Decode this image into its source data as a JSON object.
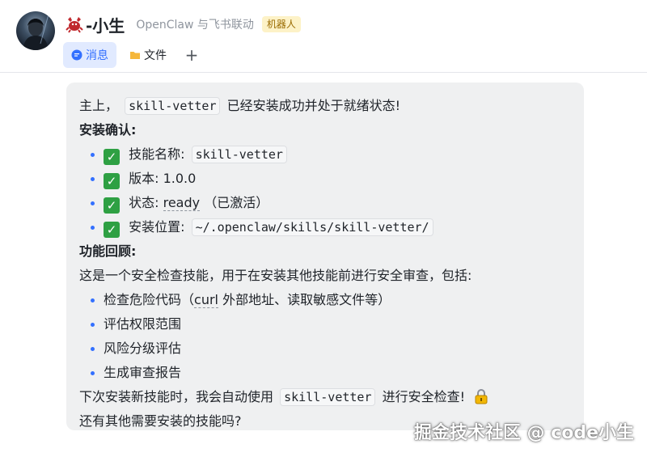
{
  "header": {
    "bot_name": "-小生",
    "subtitle": "OpenClaw 与飞书联动",
    "tag": "机器人",
    "tabs": [
      {
        "label": "消息",
        "icon": "chat-bubble-icon",
        "active": true
      },
      {
        "label": "文件",
        "icon": "folder-icon",
        "active": false
      }
    ],
    "add_tab_label": "+"
  },
  "message": {
    "intro_prefix": "主上，",
    "intro_code": "skill-vetter",
    "intro_suffix": "已经安装成功并处于就绪状态!",
    "install_heading": "安装确认:",
    "install_items": [
      {
        "check": "✓",
        "label": "技能名称:",
        "code": "skill-vetter",
        "value": ""
      },
      {
        "check": "✓",
        "label": "版本:",
        "code": "",
        "value": "1.0.0"
      },
      {
        "check": "✓",
        "label": "状态:",
        "code": "",
        "value": "ready",
        "suffix": "（已激活）"
      },
      {
        "check": "✓",
        "label": "安装位置:",
        "code": "~/.openclaw/skills/skill-vetter/",
        "value": ""
      }
    ],
    "feature_heading": "功能回顾:",
    "feature_intro": "这是一个安全检查技能，用于在安装其他技能前进行安全审查，包括:",
    "feature_items": [
      {
        "prefix": "检查危险代码（",
        "term": "curl",
        "suffix": " 外部地址、读取敏感文件等）"
      },
      {
        "prefix": "评估权限范围",
        "term": "",
        "suffix": ""
      },
      {
        "prefix": "风险分级评估",
        "term": "",
        "suffix": ""
      },
      {
        "prefix": "生成审查报告",
        "term": "",
        "suffix": ""
      }
    ],
    "next_prefix": "下次安装新技能时，我会自动使用",
    "next_code": "skill-vetter",
    "next_suffix": "进行安全检查!",
    "closing": "还有其他需要安装的技能吗?"
  },
  "watermark": "掘金技术社区 @ code小生",
  "colors": {
    "accent": "#3370ff",
    "tab_active_bg": "#e1eaff",
    "bubble_bg": "#eff0f1",
    "check_green": "#2ea043",
    "tag_bg": "#fdf2c7"
  }
}
